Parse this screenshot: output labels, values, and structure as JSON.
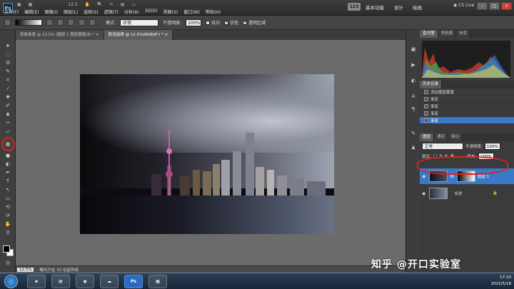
{
  "menubar": {
    "items": [
      "文件(F)",
      "编辑(E)",
      "图像(I)",
      "图层(L)",
      "选择(S)",
      "滤镜(T)",
      "分析(A)",
      "3D(D)",
      "视图(V)",
      "窗口(W)",
      "帮助(H)"
    ],
    "top_zoom": "12.5",
    "workspace_badge": "123",
    "workspace_basic": "基本功能",
    "workspace_design": "设计",
    "workspace_paint": "绘画",
    "cs_live": "CS Live",
    "btn_min": "–",
    "btn_max": "□",
    "btn_close": "×"
  },
  "options": {
    "mode_label": "模式:",
    "mode_value": "正常",
    "opacity_label": "不透明度:",
    "opacity_value": "100%",
    "reverse_label": "反向",
    "dither_label": "仿色",
    "transparency_label": "透明区域"
  },
  "tabs": [
    "修复画笔 @ 12.5% (图层 1 图层蒙版/8) * ×",
    "取消选择 @ 12.5%(RGB/8*) * ×"
  ],
  "panels": {
    "histogram_tabs": [
      "直方图",
      "导航器",
      "信息"
    ],
    "history_tab": "历史记录",
    "history_items": [
      "添加图层蒙版",
      "渐变",
      "渐变",
      "渐变",
      "渐变"
    ],
    "layers_tabs": [
      "图层",
      "通道",
      "路径"
    ],
    "blend_mode": "正常",
    "opacity_label": "不透明度:",
    "opacity_value": "100%",
    "lock_label": "锁定:",
    "fill_label": "填充:",
    "fill_value": "100%",
    "layer1_name": "图层 1",
    "background_name": "背景"
  },
  "status": {
    "zoom": "12.5%",
    "message": "曝光只在 32 位起作用"
  },
  "watermark": "知乎 @开口实验室",
  "taskbar": {
    "ps_label": "Ps",
    "time": "17:10",
    "date": "2015/5/18"
  }
}
